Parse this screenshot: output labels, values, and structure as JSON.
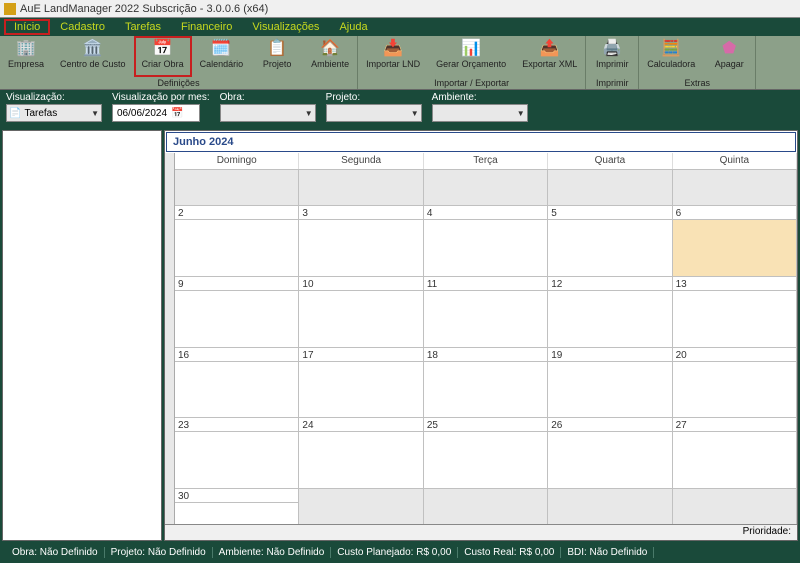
{
  "title": "AuE LandManager 2022 Subscrição - 3.0.0.6 (x64)",
  "menu": {
    "inicio": "Início",
    "cadastro": "Cadastro",
    "tarefas": "Tarefas",
    "financeiro": "Financeiro",
    "visualizacoes": "Visualizações",
    "ajuda": "Ajuda"
  },
  "toolbar": {
    "groups": {
      "definicoes": "Definições",
      "importar_exportar": "Importar / Exportar",
      "imprimir": "Imprimir",
      "extras": "Extras"
    },
    "empresa": "Empresa",
    "centro_custo": "Centro de Custo",
    "criar_obra": "Criar Obra",
    "calendario": "Calendário",
    "projeto": "Projeto",
    "ambiente": "Ambiente",
    "importar_lnd": "Importar LND",
    "gerar_orcamento": "Gerar Orçamento",
    "exportar_xml": "Exportar XML",
    "imprimir": "Imprimir",
    "calculadora": "Calculadora",
    "apagar": "Apagar"
  },
  "controls": {
    "visualizacao_label": "Visualização:",
    "visualizacao_value": "Tarefas",
    "mes_label": "Visualização por mes:",
    "mes_value": "06/06/2024",
    "obra_label": "Obra:",
    "obra_value": "",
    "projeto_label": "Projeto:",
    "projeto_value": "",
    "ambiente_label": "Ambiente:",
    "ambiente_value": ""
  },
  "calendar": {
    "title": "Junho 2024",
    "dow": {
      "dom": "Domingo",
      "seg": "Segunda",
      "ter": "Terça",
      "qua": "Quarta",
      "qui": "Quinta"
    },
    "weeks": [
      {
        "d0": "2",
        "d1": "3",
        "d2": "4",
        "d3": "5",
        "d4": "6"
      },
      {
        "d0": "9",
        "d1": "10",
        "d2": "11",
        "d3": "12",
        "d4": "13"
      },
      {
        "d0": "16",
        "d1": "17",
        "d2": "18",
        "d3": "19",
        "d4": "20"
      },
      {
        "d0": "23",
        "d1": "24",
        "d2": "25",
        "d3": "26",
        "d4": "27"
      },
      {
        "d0": "30",
        "d1": "",
        "d2": "",
        "d3": "",
        "d4": ""
      }
    ]
  },
  "priority_label": "Prioridade:",
  "status": {
    "obra": "Obra: Não Definido",
    "projeto": "Projeto: Não Definido",
    "ambiente": "Ambiente: Não Definido",
    "planejado": "Custo Planejado: R$ 0,00",
    "real": "Custo Real: R$ 0,00",
    "bdi": "BDI: Não Definido"
  }
}
